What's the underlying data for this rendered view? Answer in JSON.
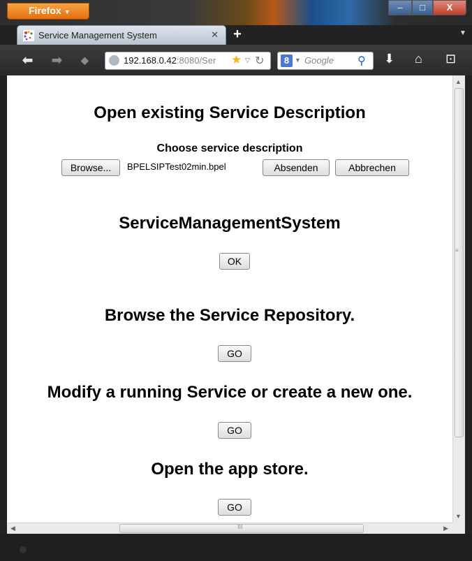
{
  "browser": {
    "menu_button": "Firefox",
    "tab_title": "Service Management System",
    "url_host": "192.168.0.42",
    "url_rest": ":8080/Ser",
    "search_placeholder": "Google",
    "window_controls": {
      "minimize": "–",
      "maximize": "□",
      "close": "X"
    },
    "icons": [
      "back-icon",
      "forward-icon",
      "reload-icon",
      "star-icon",
      "google-search-icon",
      "download-icon",
      "home-icon",
      "addon-bar-icon"
    ]
  },
  "page": {
    "section1": {
      "title": "Open existing Service Description",
      "subtitle": "Choose service description",
      "browse_label": "Browse...",
      "file_name": "BPELSIPTest02min.bpel",
      "submit_label": "Absenden",
      "cancel_label": "Abbrechen"
    },
    "section2": {
      "title": "ServiceManagementSystem",
      "button": "OK"
    },
    "section3": {
      "title": "Browse the Service Repository.",
      "button": "GO"
    },
    "section4": {
      "title": "Modify a running Service or create a new one.",
      "button": "GO"
    },
    "section5": {
      "title": "Open the app store.",
      "button": "GO"
    }
  },
  "scrollbar_hint": "III"
}
